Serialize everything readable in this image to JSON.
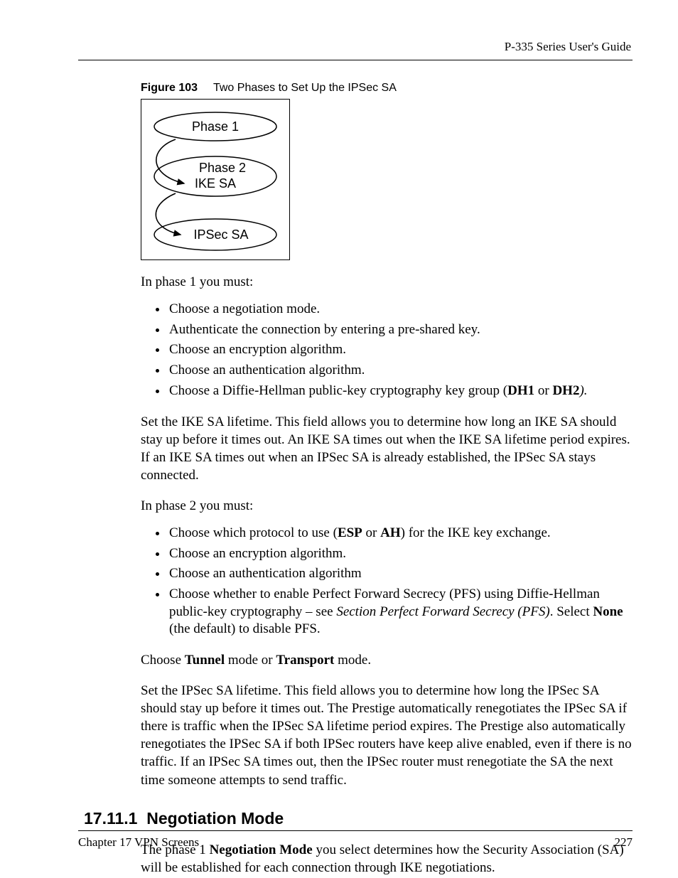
{
  "header": {
    "guide_title": "P-335 Series User's Guide"
  },
  "figure": {
    "label": "Figure 103",
    "caption": "Two Phases to Set Up the IPSec SA",
    "labels": {
      "phase1": "Phase 1",
      "phase2": "Phase 2",
      "ike": "IKE SA",
      "ipsec": "IPSec SA"
    }
  },
  "p1_intro": "In phase 1 you must:",
  "p1_list": {
    "i0": "Choose a negotiation mode.",
    "i1": "Authenticate the connection by entering a pre-shared key.",
    "i2": "Choose an encryption algorithm.",
    "i3": "Choose an authentication algorithm.",
    "i4_pre": "Choose a Diffie-Hellman public-key cryptography key group (",
    "i4_dh1": "DH1",
    "i4_or": " or ",
    "i4_dh2": "DH2",
    "i4_post": ")."
  },
  "ike_lifetime": "Set the IKE SA lifetime. This field allows you to determine how long an IKE SA should stay up before it times out. An IKE SA times out when the IKE SA lifetime period expires. If an IKE SA times out when an IPSec SA is already established, the IPSec SA stays connected.",
  "p2_intro": "In phase 2 you must:",
  "p2_list": {
    "i0_pre": "Choose which protocol to use (",
    "i0_esp": "ESP",
    "i0_or": " or ",
    "i0_ah": "AH",
    "i0_post": ") for the IKE key exchange.",
    "i1": "Choose an encryption algorithm.",
    "i2": "Choose an authentication algorithm",
    "i3_pre": "Choose whether to enable Perfect Forward Secrecy (PFS) using Diffie-Hellman public-key cryptography – see ",
    "i3_ref": "Section Perfect Forward Secrecy (PFS)",
    "i3_mid": ". Select ",
    "i3_none": "None",
    "i3_post": " (the default) to disable PFS."
  },
  "mode_choice": {
    "pre": "Choose ",
    "tunnel": "Tunnel",
    "mid": " mode or ",
    "transport": "Transport",
    "post": " mode."
  },
  "ipsec_lifetime": "Set the IPSec SA lifetime. This field allows you to determine how long the IPSec SA should stay up before it times out. The Prestige automatically renegotiates the IPSec SA if there is traffic when the IPSec SA lifetime period expires. The Prestige also automatically renegotiates the IPSec SA if both IPSec routers have keep alive enabled, even if there is no traffic. If an IPSec SA times out, then the IPSec router must renegotiate the SA the next time someone attempts to send traffic.",
  "section": {
    "number": "17.11.1",
    "title": "Negotiation Mode"
  },
  "neg_para": {
    "pre": "The phase 1 ",
    "bold": "Negotiation Mode",
    "post": " you select determines how the Security Association (SA) will be established for each connection through IKE negotiations."
  },
  "footer": {
    "chapter": "Chapter 17 VPN Screens",
    "page": "227"
  }
}
